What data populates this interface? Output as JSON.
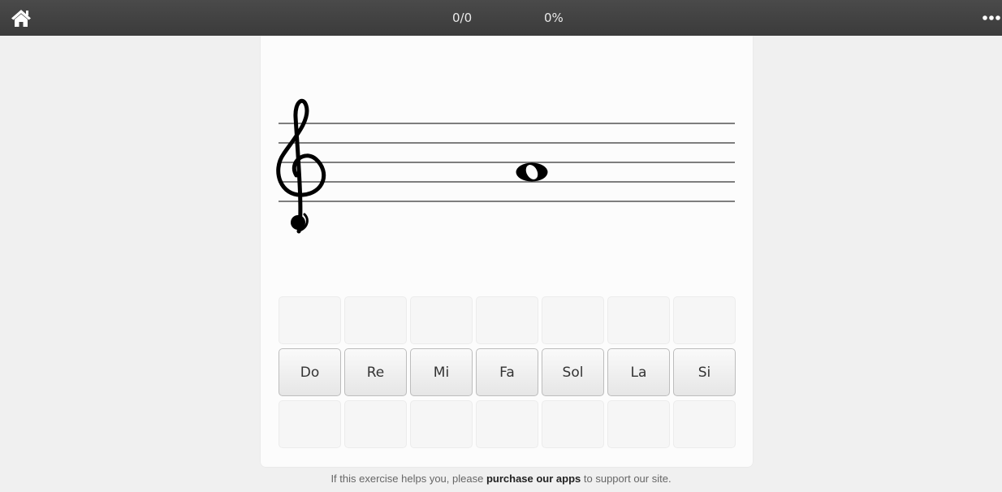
{
  "header": {
    "home_icon": "home-icon",
    "score_count": "0/0",
    "score_percent": "0%",
    "more_icon": "more-horizontal-icon"
  },
  "staff": {
    "clef": "treble-clef-icon",
    "note": "whole-note"
  },
  "answer_buttons": [
    {
      "label": "Do"
    },
    {
      "label": "Re"
    },
    {
      "label": "Mi"
    },
    {
      "label": "Fa"
    },
    {
      "label": "Sol"
    },
    {
      "label": "La"
    },
    {
      "label": "Si"
    }
  ],
  "footer": {
    "prefix": "If this exercise helps you, please",
    "link": "purchase our apps",
    "suffix": "to support our site."
  }
}
